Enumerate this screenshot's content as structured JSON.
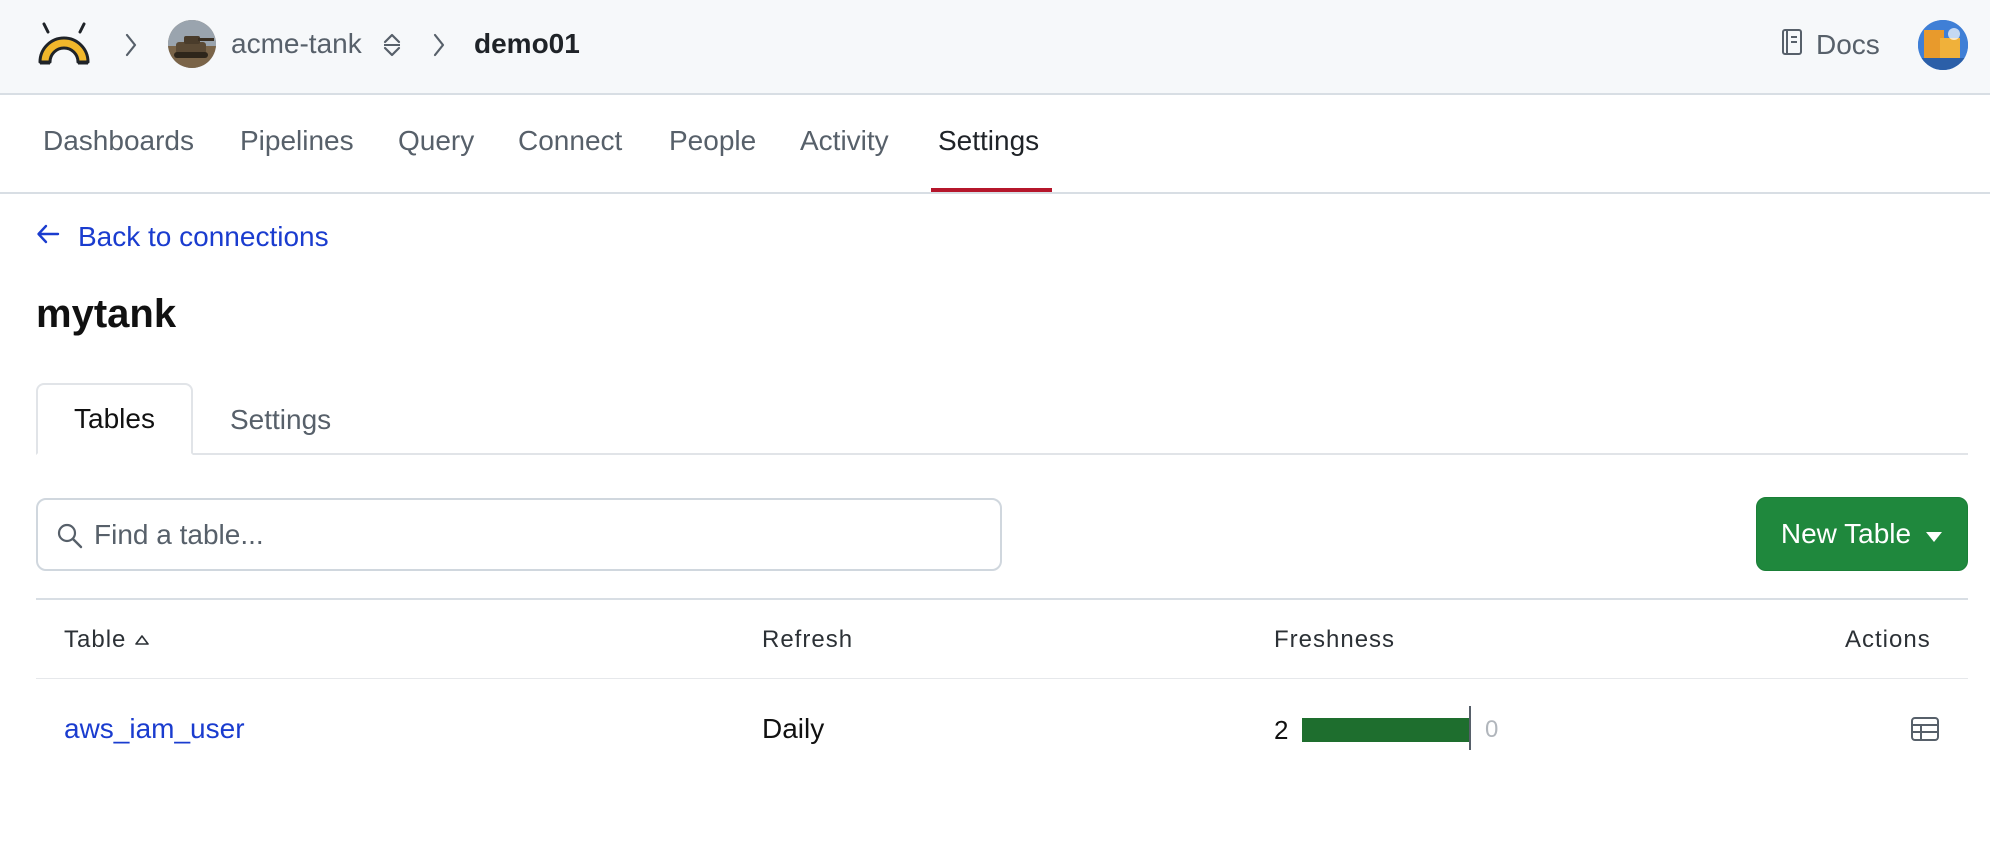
{
  "topbar": {
    "org_name": "acme-tank",
    "workspace_name": "demo01",
    "docs_label": "Docs"
  },
  "nav": {
    "items": [
      {
        "label": "Dashboards"
      },
      {
        "label": "Pipelines"
      },
      {
        "label": "Query"
      },
      {
        "label": "Connect"
      },
      {
        "label": "People"
      },
      {
        "label": "Activity"
      },
      {
        "label": "Settings",
        "active": true
      }
    ]
  },
  "back_link": "Back to connections",
  "page_title": "mytank",
  "subtabs": [
    {
      "label": "Tables",
      "active": true
    },
    {
      "label": "Settings"
    }
  ],
  "search": {
    "placeholder": "Find a table...",
    "value": ""
  },
  "new_table_button": "New Table",
  "table": {
    "columns": [
      "Table",
      "Refresh",
      "Freshness",
      "Actions"
    ],
    "sort_indicator": "Table ascending",
    "rows": [
      {
        "name": "aws_iam_user",
        "refresh": "Daily",
        "freshness_value": "2",
        "freshness_max": "0",
        "freshness_fraction": 1.0
      }
    ]
  },
  "colors": {
    "accent_underline": "#b5162b",
    "link": "#1a3ccf",
    "primary_button": "#1f883d",
    "freshness_bar": "#1e6e2e",
    "logo": "#f1b72b"
  }
}
